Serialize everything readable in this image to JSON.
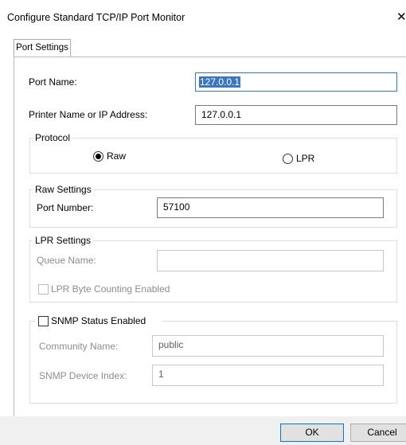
{
  "window": {
    "title": "Configure Standard TCP/IP Port Monitor",
    "close_glyph": "✕"
  },
  "tabs": [
    {
      "label": "Port Settings"
    }
  ],
  "port_name": {
    "label": "Port Name:",
    "value": "127.0.0.1"
  },
  "printer_address": {
    "label": "Printer Name or IP Address:",
    "value": "127.0.0.1"
  },
  "protocol": {
    "legend": "Protocol",
    "raw_label": "Raw",
    "lpr_label": "LPR",
    "selected": "Raw"
  },
  "raw_settings": {
    "legend": "Raw Settings",
    "port_number_label": "Port Number:",
    "port_number_value": "57100"
  },
  "lpr_settings": {
    "legend": "LPR Settings",
    "queue_name_label": "Queue Name:",
    "queue_name_value": "",
    "byte_counting_label": "LPR Byte Counting Enabled",
    "byte_counting_checked": false
  },
  "snmp": {
    "enabled_label": "SNMP Status Enabled",
    "enabled_checked": false,
    "community_label": "Community Name:",
    "community_value": "public",
    "device_index_label": "SNMP Device Index:",
    "device_index_value": "1"
  },
  "buttons": {
    "ok": "OK",
    "cancel": "Cancel"
  }
}
